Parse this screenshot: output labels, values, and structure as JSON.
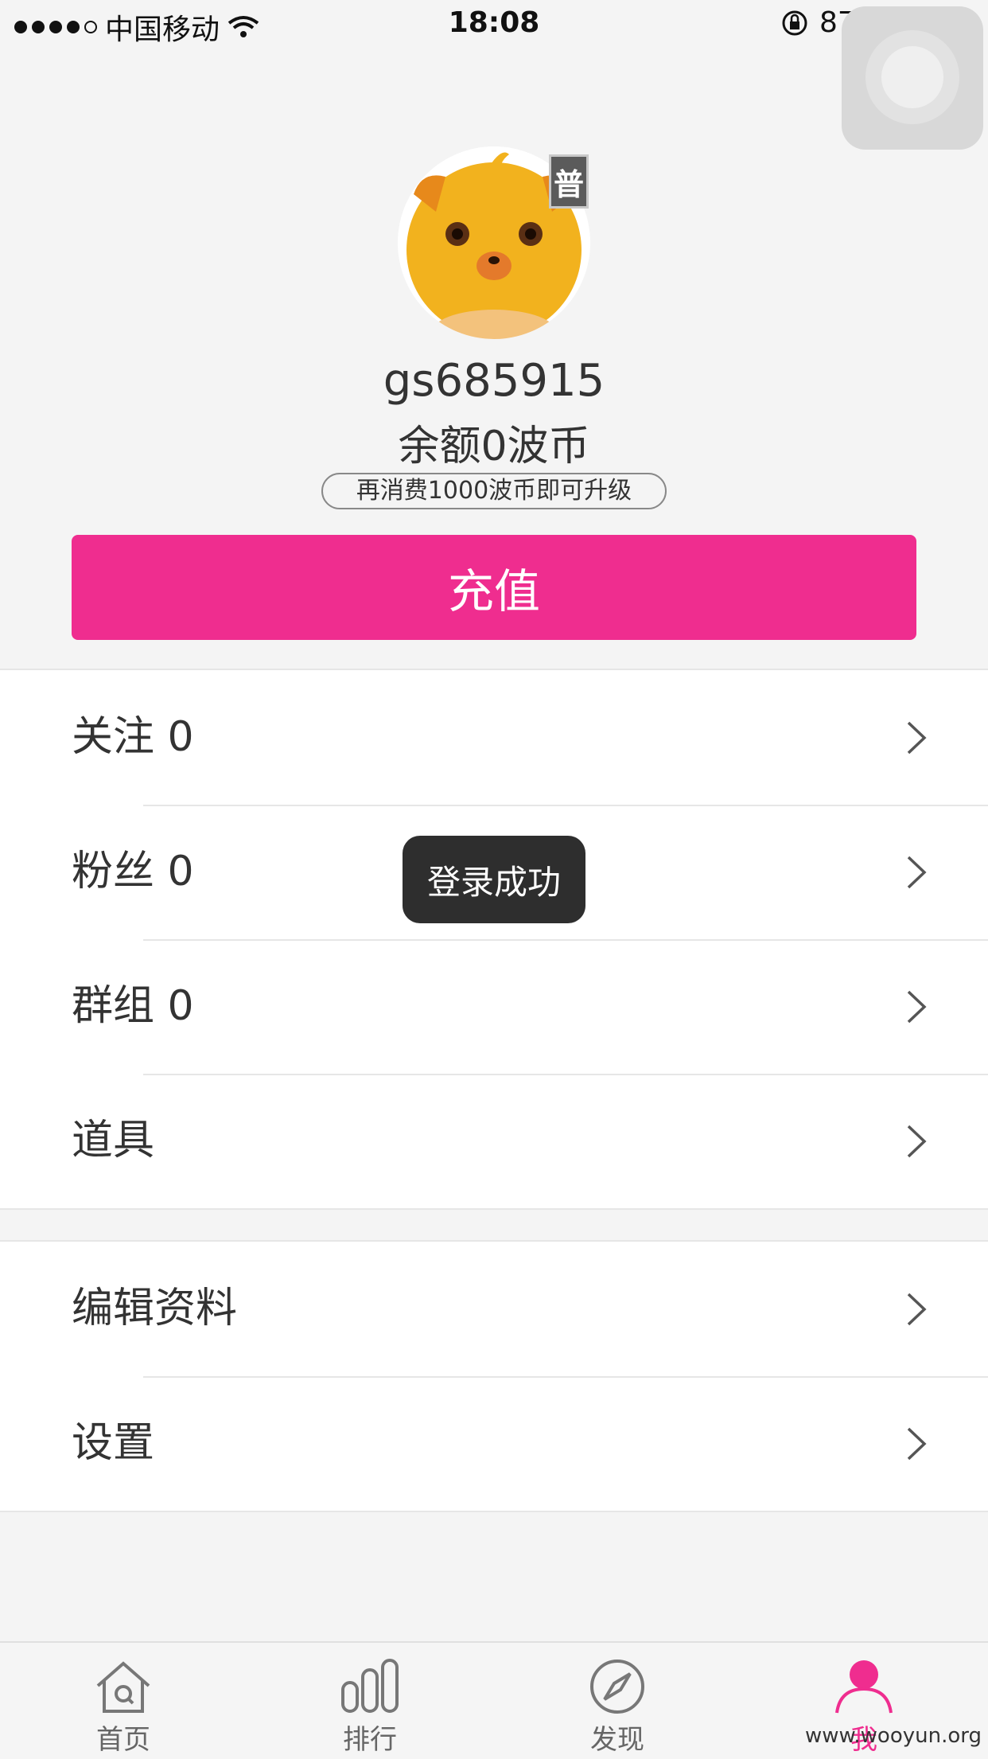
{
  "status_bar": {
    "carrier": "中国移动",
    "time": "18:08",
    "battery": "87%",
    "battery_level": 0.87
  },
  "profile": {
    "level_badge": "普",
    "username": "gs685915",
    "balance": "余额0波币",
    "upgrade_hint": "再消费1000波币即可升级",
    "recharge_label": "充值"
  },
  "menu_group_1": [
    {
      "label": "关注 0"
    },
    {
      "label": "粉丝 0"
    },
    {
      "label": "群组 0"
    },
    {
      "label": "道具"
    }
  ],
  "menu_group_2": [
    {
      "label": "编辑资料"
    },
    {
      "label": "设置"
    }
  ],
  "toast": "登录成功",
  "tabbar": [
    {
      "label": "首页",
      "icon": "home-icon"
    },
    {
      "label": "排行",
      "icon": "ranking-icon"
    },
    {
      "label": "发现",
      "icon": "compass-icon"
    },
    {
      "label": "我",
      "icon": "person-icon",
      "active": true
    }
  ],
  "watermark": "www.wooyun.org",
  "colors": {
    "accent": "#ef2d8f",
    "background": "#f4f4f4",
    "toast_bg": "#2e2e2e"
  }
}
